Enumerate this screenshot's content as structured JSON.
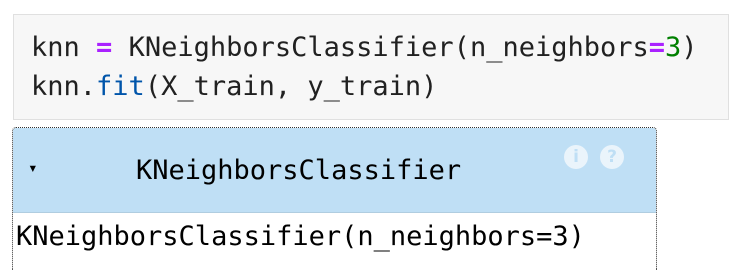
{
  "code_cell": {
    "line1": {
      "var": "knn",
      "op": "=",
      "call": "KNeighborsClassifier(n_neighbors",
      "kw_op": "=",
      "num": "3",
      "close": ")"
    },
    "line2": {
      "obj": "knn.",
      "method": "fit",
      "args": "(X_train, y_train)"
    }
  },
  "estimator": {
    "toggle_glyph": "▾",
    "name": "KNeighborsClassifier",
    "info_icon_glyph": "i",
    "doc_icon_glyph": "?",
    "repr": "KNeighborsClassifier(n_neighbors=3)"
  },
  "colors": {
    "operator": "#aa22ff",
    "number": "#008000",
    "function": "#0055aa",
    "estimator_header": "#bfdff5",
    "code_background": "#f7f7f7"
  }
}
